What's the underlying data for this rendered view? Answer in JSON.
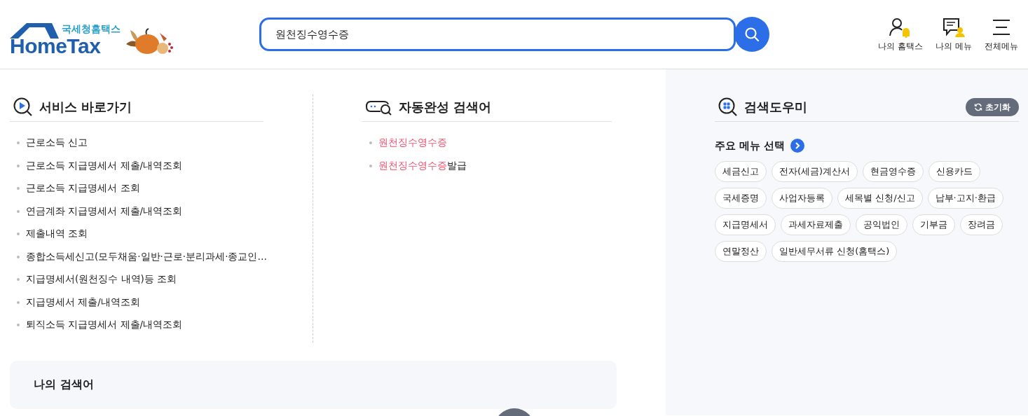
{
  "logo": {
    "subtitle": "국세청홈택스",
    "title": "HomeTax"
  },
  "search": {
    "value": "원천징수영수증"
  },
  "header_menu": [
    {
      "label": "나의 홈택스",
      "kind": "person-bell"
    },
    {
      "label": "나의 메뉴",
      "kind": "menu-person"
    },
    {
      "label": "전체메뉴",
      "kind": "hamburger"
    }
  ],
  "service_shortcuts": {
    "title": "서비스 바로가기",
    "items": [
      "근로소득 신고",
      "근로소득 지급명세서 제출/내역조회",
      "근로소득 지급명세서 조회",
      "연금계좌 지급명세서 제출/내역조회",
      "제출내역 조회",
      "종합소득세신고(모두채움·일반·근로·분리과세·종교인…",
      "지급명세서(원천징수 내역)등 조회",
      "지급명세서 제출/내역조회",
      "퇴직소득 지급명세서 제출/내역조회"
    ]
  },
  "autocomplete": {
    "title": "자동완성 검색어",
    "items": [
      {
        "match": "원천징수영수증"
      },
      {
        "match": "원천징수영수증",
        "rest": "발급"
      }
    ]
  },
  "my_searches": {
    "title": "나의 검색어"
  },
  "search_helper": {
    "title": "검색도우미",
    "reset": "초기화",
    "subtitle": "주요 메뉴 선택",
    "tags": [
      "세금신고",
      "전자(세금)계산서",
      "현금영수증",
      "신용카드",
      "국세증명",
      "사업자등록",
      "세목별 신청/신고",
      "납부·고지·환급",
      "지급명세서",
      "과세자료제출",
      "공익법인",
      "기부금",
      "장려금",
      "연말정산",
      "일반세무서류 신청(홈택스)"
    ]
  }
}
